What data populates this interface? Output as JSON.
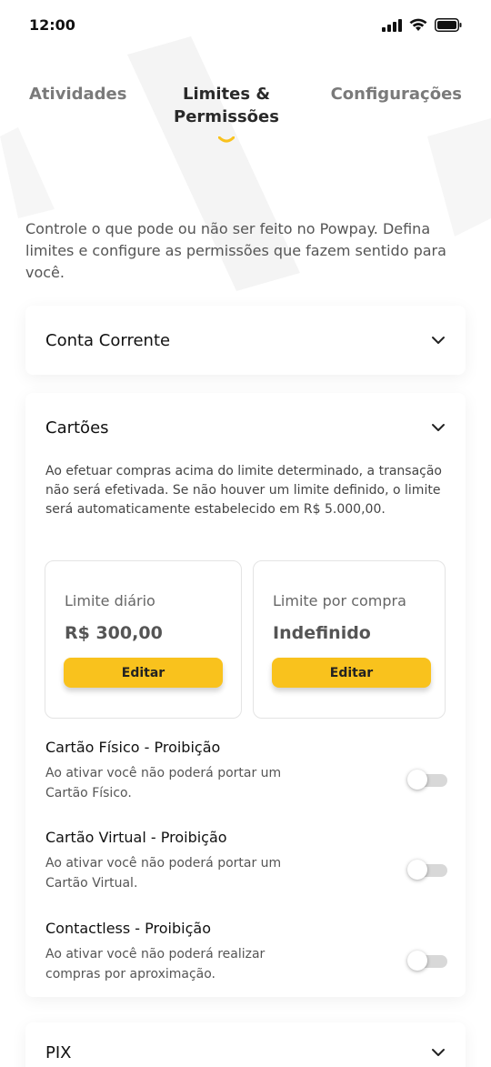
{
  "status": {
    "time": "12:00"
  },
  "tabs": [
    {
      "label": "Atividades",
      "active": false
    },
    {
      "label": "Limites &\nPermissões",
      "active": true
    },
    {
      "label": "Configurações",
      "active": false
    }
  ],
  "intro": "Controle o que pode ou não ser feito no Powpay. Defina limites e configure as permissões que fazem sentido para você.",
  "sections": {
    "conta_corrente": {
      "title": "Conta Corrente"
    },
    "cartoes": {
      "title": "Cartões",
      "description": "Ao efetuar compras acima do limite determinado, a transação não será efetivada. Se não houver um limite definido, o limite será automaticamente estabelecido em R$ 5.000,00.",
      "limits": [
        {
          "label": "Limite diário",
          "value": "R$ 300,00",
          "button": "Editar"
        },
        {
          "label": "Limite por compra",
          "value": "Indefinido",
          "button": "Editar"
        }
      ],
      "toggles": [
        {
          "title": "Cartão Físico - Proibição",
          "description": "Ao ativar você não poderá portar um Cartão Físico.",
          "on": false
        },
        {
          "title": "Cartão Virtual - Proibição",
          "description": "Ao ativar você não poderá portar um Cartão Virtual.",
          "on": false
        },
        {
          "title": "Contactless - Proibição",
          "description": "Ao ativar você não poderá realizar compras por aproximação.",
          "on": false
        }
      ]
    },
    "pix": {
      "title": "PIX"
    }
  },
  "colors": {
    "accent": "#f9c21d",
    "text": "#111111",
    "muted": "#7a7a7a"
  },
  "icons": [
    "signal-icon",
    "wifi-icon",
    "battery-icon",
    "chevron-down-icon",
    "toggle-switch"
  ]
}
